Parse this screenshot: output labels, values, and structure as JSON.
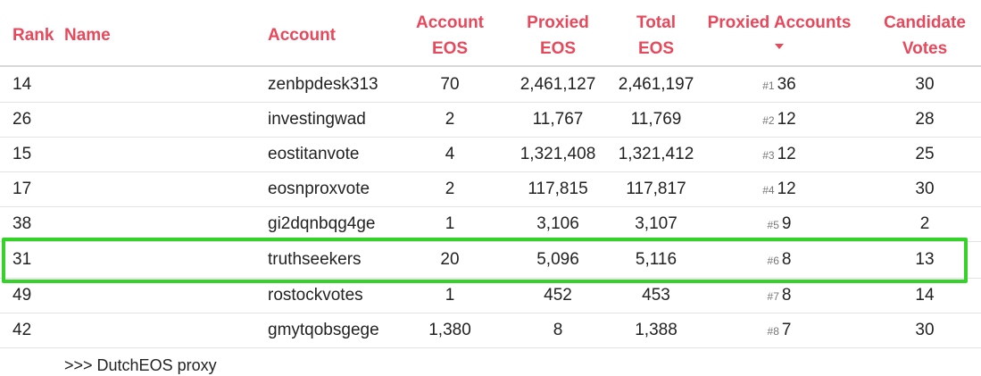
{
  "headers": {
    "rank": "Rank",
    "name": "Name",
    "account": "Account",
    "account_eos": [
      "Account",
      "EOS"
    ],
    "proxied_eos": [
      "Proxied",
      "EOS"
    ],
    "total_eos": [
      "Total",
      "EOS"
    ],
    "proxied_accounts": "Proxied Accounts",
    "candidate_votes": [
      "Candidate",
      "Votes"
    ]
  },
  "rows": [
    {
      "rank": "14",
      "name": "",
      "account": "zenbpdesk313",
      "account_eos": "70",
      "proxied_eos": "2,461,127",
      "total_eos": "2,461,197",
      "pa_rank": "#1",
      "proxied_accounts": "36",
      "candidate_votes": "30"
    },
    {
      "rank": "26",
      "name": "",
      "account": "investingwad",
      "account_eos": "2",
      "proxied_eos": "11,767",
      "total_eos": "11,769",
      "pa_rank": "#2",
      "proxied_accounts": "12",
      "candidate_votes": "28"
    },
    {
      "rank": "15",
      "name": "",
      "account": "eostitanvote",
      "account_eos": "4",
      "proxied_eos": "1,321,408",
      "total_eos": "1,321,412",
      "pa_rank": "#3",
      "proxied_accounts": "12",
      "candidate_votes": "25"
    },
    {
      "rank": "17",
      "name": "",
      "account": "eosnproxvote",
      "account_eos": "2",
      "proxied_eos": "117,815",
      "total_eos": "117,817",
      "pa_rank": "#4",
      "proxied_accounts": "12",
      "candidate_votes": "30"
    },
    {
      "rank": "38",
      "name": "",
      "account": "gi2dqnbqg4ge",
      "account_eos": "1",
      "proxied_eos": "3,106",
      "total_eos": "3,107",
      "pa_rank": "#5",
      "proxied_accounts": "9",
      "candidate_votes": "2"
    },
    {
      "rank": "31",
      "name": "",
      "account": "truthseekers",
      "account_eos": "20",
      "proxied_eos": "5,096",
      "total_eos": "5,116",
      "pa_rank": "#6",
      "proxied_accounts": "8",
      "candidate_votes": "13"
    },
    {
      "rank": "49",
      "name": "",
      "account": "rostockvotes",
      "account_eos": "1",
      "proxied_eos": "452",
      "total_eos": "453",
      "pa_rank": "#7",
      "proxied_accounts": "8",
      "candidate_votes": "14"
    },
    {
      "rank": "42",
      "name": "",
      "account": "gmytqobsgege",
      "account_eos": "1,380",
      "proxied_eos": "8",
      "total_eos": "1,388",
      "pa_rank": "#8",
      "proxied_accounts": "7",
      "candidate_votes": "30"
    }
  ],
  "partial_row": {
    "name": ">>> DutchEOS proxy"
  },
  "colors": {
    "header": "#e8485b",
    "highlight": "#35d22a",
    "divider": "#e2e2e2"
  }
}
